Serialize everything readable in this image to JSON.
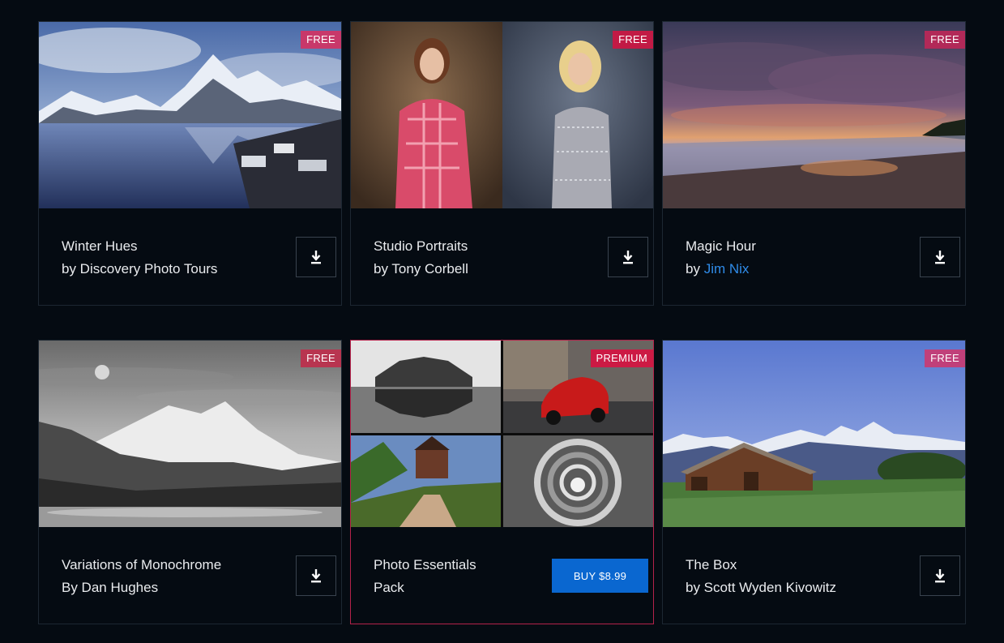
{
  "cards": [
    {
      "title": "Winter Hues",
      "author": "by Discovery Photo Tours",
      "badge": "FREE",
      "badge_color": "#c8386a"
    },
    {
      "title": "Studio Portraits",
      "author": "by Tony Corbell",
      "badge": "FREE",
      "badge_color": "#c21a45"
    },
    {
      "title": "Magic Hour",
      "author_prefix": "by ",
      "author_link": "Jim Nix",
      "badge": "FREE",
      "badge_color": "#b22958"
    },
    {
      "title": "Variations of Monochrome",
      "author": "By Dan Hughes",
      "badge": "FREE",
      "badge_color": "#b83550"
    },
    {
      "title": "Photo Essentials",
      "title_line2": "Pack",
      "badge": "PREMIUM",
      "badge_color": "#cc1a44",
      "buy_label": "BUY $8.99"
    },
    {
      "title": "The Box",
      "author": "by Scott Wyden Kivowitz",
      "badge": "FREE",
      "badge_color": "#c0407a"
    }
  ],
  "colors": {
    "background": "#050b12",
    "link": "#2f8be8",
    "buy_button": "#0a67d0",
    "premium_border": "#b4224a"
  },
  "icons": {
    "download": "download-icon"
  }
}
